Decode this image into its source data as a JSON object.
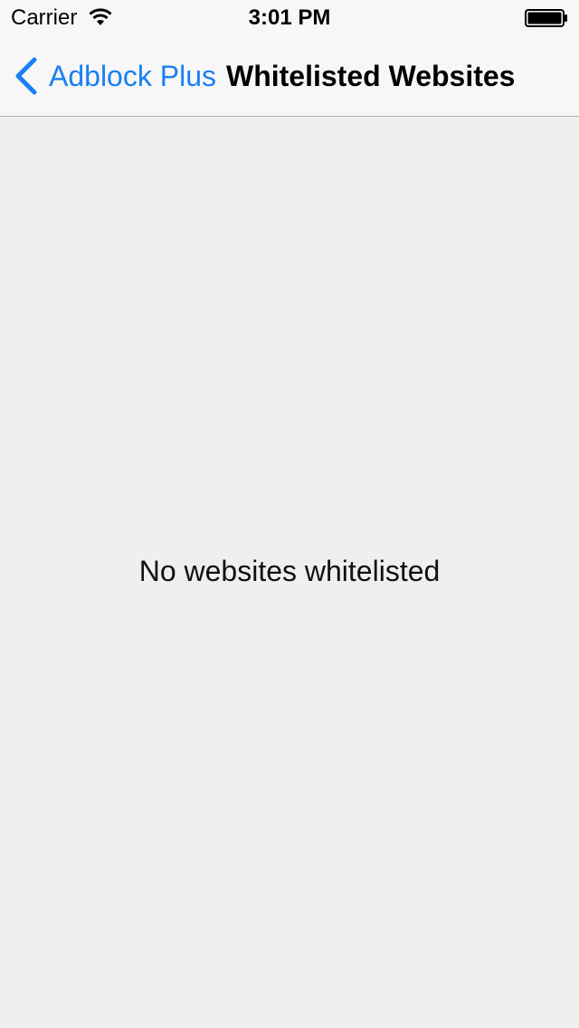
{
  "status_bar": {
    "carrier": "Carrier",
    "time": "3:01 PM",
    "wifi_icon": "wifi-icon",
    "battery_icon": "battery-icon"
  },
  "nav_bar": {
    "back_label": "Adblock Plus",
    "back_icon": "chevron-left-icon",
    "title": "Whitelisted Websites",
    "accent_color": "#1a7ff4"
  },
  "main": {
    "empty_message": "No websites whitelisted",
    "background_color": "#efefef"
  }
}
